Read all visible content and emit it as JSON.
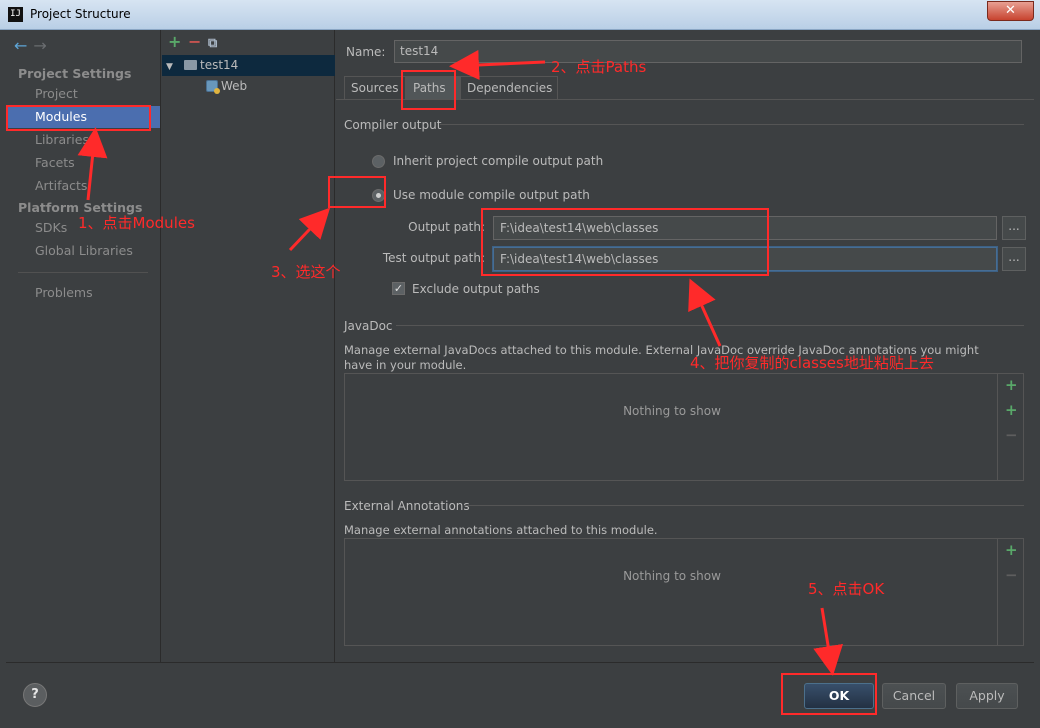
{
  "window": {
    "title": "Project Structure",
    "app_icon": "IJ",
    "close_glyph": "✕"
  },
  "sidebar": {
    "back_icon": "←",
    "forward_icon": "→",
    "project_settings_title": "Project Settings",
    "project_settings_items": [
      "Project",
      "Modules",
      "Libraries",
      "Facets",
      "Artifacts"
    ],
    "platform_settings_title": "Platform Settings",
    "platform_settings_items": [
      "SDKs",
      "Global Libraries"
    ],
    "problems": "Problems",
    "selected": "Modules"
  },
  "tree": {
    "toolbar": {
      "add": "+",
      "remove": "−",
      "copy": "⧉"
    },
    "module": "test14",
    "facet": "Web",
    "expand_glyph": "▼"
  },
  "module": {
    "name_label": "Name:",
    "name_value": "test14",
    "tabs": [
      "Sources",
      "Paths",
      "Dependencies"
    ],
    "active_tab": "Paths"
  },
  "compiler_output": {
    "title": "Compiler output",
    "inherit_label": "Inherit project compile output path",
    "use_module_label": "Use module compile output path",
    "selected": "use_module",
    "output_path_label": "Output path:",
    "output_path_value": "F:\\idea\\test14\\web\\classes",
    "test_output_path_label": "Test output path:",
    "test_output_path_value": "F:\\idea\\test14\\web\\classes",
    "browse_label": "...",
    "exclude_label": "Exclude output paths",
    "exclude_checked": true,
    "check_glyph": "✓"
  },
  "javadoc": {
    "title": "JavaDoc",
    "description": "Manage external JavaDocs attached to this module. External JavaDoc override JavaDoc annotations you might have in your module.",
    "empty_text": "Nothing to show"
  },
  "external_annotations": {
    "title": "External Annotations",
    "description": "Manage external annotations attached to this module.",
    "empty_text": "Nothing to show"
  },
  "footer": {
    "help": "?",
    "ok": "OK",
    "cancel": "Cancel",
    "apply": "Apply"
  },
  "annotations": {
    "step1": "1、点击Modules",
    "step2": "2、点击Paths",
    "step3": "3、选这个",
    "step4": "4、把你复制的classes地址粘贴上去",
    "step5": "5、点击OK",
    "color": "#ff2a2a"
  },
  "colors": {
    "background": "#3c3f41",
    "selection": "#4b6eaf",
    "tree_selection": "#0d293e",
    "add_green": "#59a869",
    "remove_red": "#c75450"
  }
}
